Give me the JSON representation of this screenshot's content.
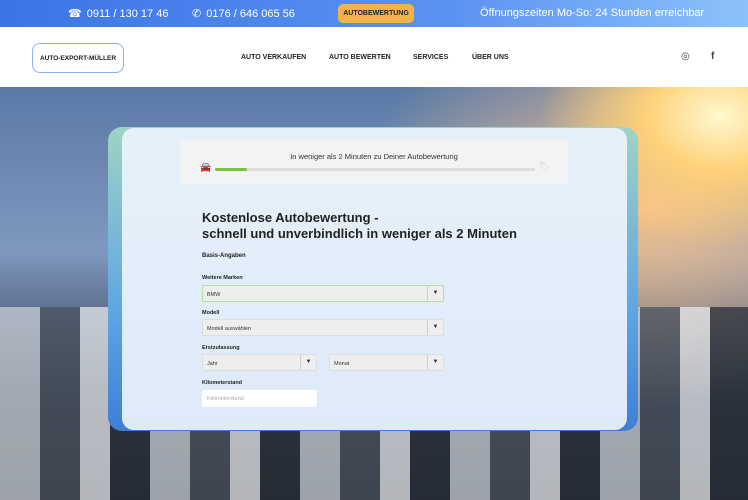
{
  "topbar": {
    "phone1": "0911 / 130 17 46",
    "phone2": "0176 / 646 065 56",
    "cta": "AUTOBEWERTUNG",
    "hours": "Öffnungszeiten Mo-So: 24 Stunden erreichbar"
  },
  "header": {
    "logo": "AUTO-EXPORT-MÜLLER",
    "nav": [
      "AUTO VERKAUFEN",
      "AUTO BEWERTEN",
      "SERVICES",
      "ÜBER UNS"
    ]
  },
  "progress": {
    "title": "In weniger als 2 Minuten zu Deiner Autobewertung",
    "percent": 10
  },
  "form": {
    "title1": "Kostenlose Autobewertung -",
    "title2": "schnell und unverbindlich in weniger als 2 Minuten",
    "section": "Basis-Angaben",
    "brand_label": "Weitere Marken",
    "brand_value": "BMW",
    "model_label": "Modell",
    "model_value": "Modell auswählen",
    "reg_label": "Erstzulassung",
    "year_value": "Jahr",
    "month_value": "Monat",
    "km_label": "Kilometerstand",
    "km_placeholder": "Kilometerstand"
  },
  "colors": {
    "accent": "#f5b347",
    "progress": "#7cc242"
  }
}
